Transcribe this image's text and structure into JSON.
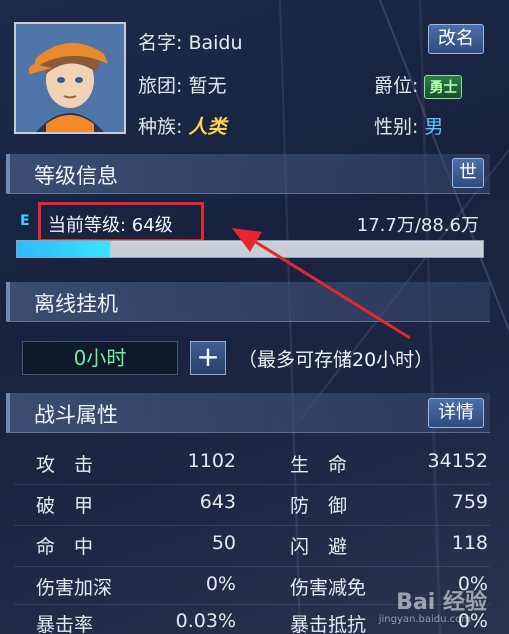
{
  "profile": {
    "name_label": "名字:",
    "name_value": "Baidu",
    "rename_button": "改名",
    "guild_label": "旅团:",
    "guild_value": "暂无",
    "rank_label": "爵位:",
    "rank_value": "勇士",
    "race_label": "种族:",
    "race_value": "人类",
    "gender_label": "性别:",
    "gender_value": "男"
  },
  "level": {
    "section_title": "等级信息",
    "world_button": "世",
    "tag": "E",
    "current_level": "当前等级: 64级",
    "exp_text": "17.7万/88.6万",
    "exp_fraction": 0.2
  },
  "offline": {
    "section_title": "离线挂机",
    "timer_value": "0小时",
    "plus_label": "+",
    "note": "（最多可存储20小时）"
  },
  "combat": {
    "section_title": "战斗属性",
    "details_button": "详情",
    "left": [
      {
        "label": "攻　击",
        "value": "1102"
      },
      {
        "label": "破　甲",
        "value": "643"
      },
      {
        "label": "命　中",
        "value": "50"
      },
      {
        "label": "伤害加深",
        "value": "0%"
      },
      {
        "label": "暴击率",
        "value": "0.03%"
      }
    ],
    "right": [
      {
        "label": "生　命",
        "value": "34152"
      },
      {
        "label": "防　御",
        "value": "759"
      },
      {
        "label": "闪　避",
        "value": "118"
      },
      {
        "label": "伤害减免",
        "value": "0%"
      },
      {
        "label": "暴击抵抗",
        "value": "0%"
      }
    ]
  },
  "watermark": {
    "logo": "Bai 经验",
    "url": "jingyan.baidu.com"
  },
  "colors": {
    "highlight_box": "#e5262e",
    "exp_fill": "#38e4ff",
    "race": "#ffd54a",
    "gender": "#5cc6ff",
    "timer": "#6cf09a"
  }
}
